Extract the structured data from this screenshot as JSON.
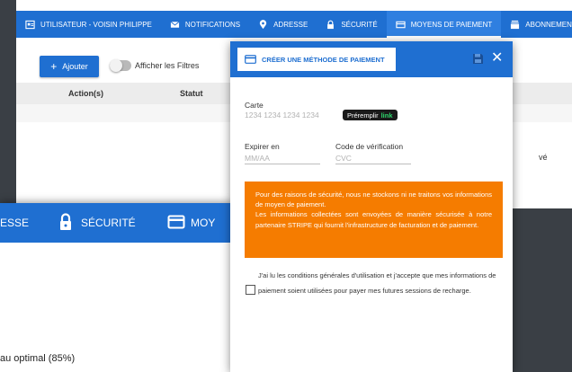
{
  "background_page": {
    "tabs": [
      {
        "label": "UTILISATEUR - VOISIN PHILIPPE",
        "icon": "user-card-icon"
      },
      {
        "label": "NOTIFICATIONS",
        "icon": "mail-icon"
      },
      {
        "label": "ADRESSE",
        "icon": "location-pin-icon"
      },
      {
        "label": "SÉCURITÉ",
        "icon": "lock-icon"
      },
      {
        "label": "MOYENS DE PAIEMENT",
        "icon": "credit-card-icon",
        "active": true
      },
      {
        "label": "ABONNEMEN",
        "icon": "subscription-icon"
      }
    ],
    "add_button_label": "Ajouter",
    "add_icon": "+",
    "filters_label": "Afficher les Filtres",
    "table_headers": [
      "Action(s)",
      "Statut"
    ],
    "partial_row_text": "vé"
  },
  "foreground_page": {
    "tabs": [
      {
        "label": "ESSE"
      },
      {
        "label": "SÉCURITÉ",
        "icon": "lock-icon"
      },
      {
        "label": "MOY",
        "icon": "credit-card-icon"
      }
    ],
    "text_line": "au optimal (85%)"
  },
  "modal": {
    "title": "CRÉER UNE MÉTHODE DE PAIEMENT",
    "close_symbol": "✕",
    "card_label": "Carte",
    "card_placeholder": "1234 1234 1234 1234",
    "prefill_label": "Préremplir",
    "prefill_link": "link",
    "expiry_label": "Expirer en",
    "expiry_placeholder": "MM/AA",
    "cvc_label": "Code de vérification",
    "cvc_placeholder": "CVC",
    "notice_line1": "Pour des raisons de sécurité, nous ne stockons ni ne traitons vos informations de moyen de paiement.",
    "notice_line2": "Les informations collectées sont envoyées de manière sécurisée à notre partenaire STRIPE qui fournit l'infrastructure de facturation et de paiement.",
    "consent_text": "J'ai lu les conditions générales d'utilisation et j'accepte que mes informations de paiement soient utilisées pour payer mes futures sessions de recharge."
  },
  "colors": {
    "primary": "#1f6fd1",
    "notice": "#f57c00",
    "link_green": "#2dd56a"
  }
}
